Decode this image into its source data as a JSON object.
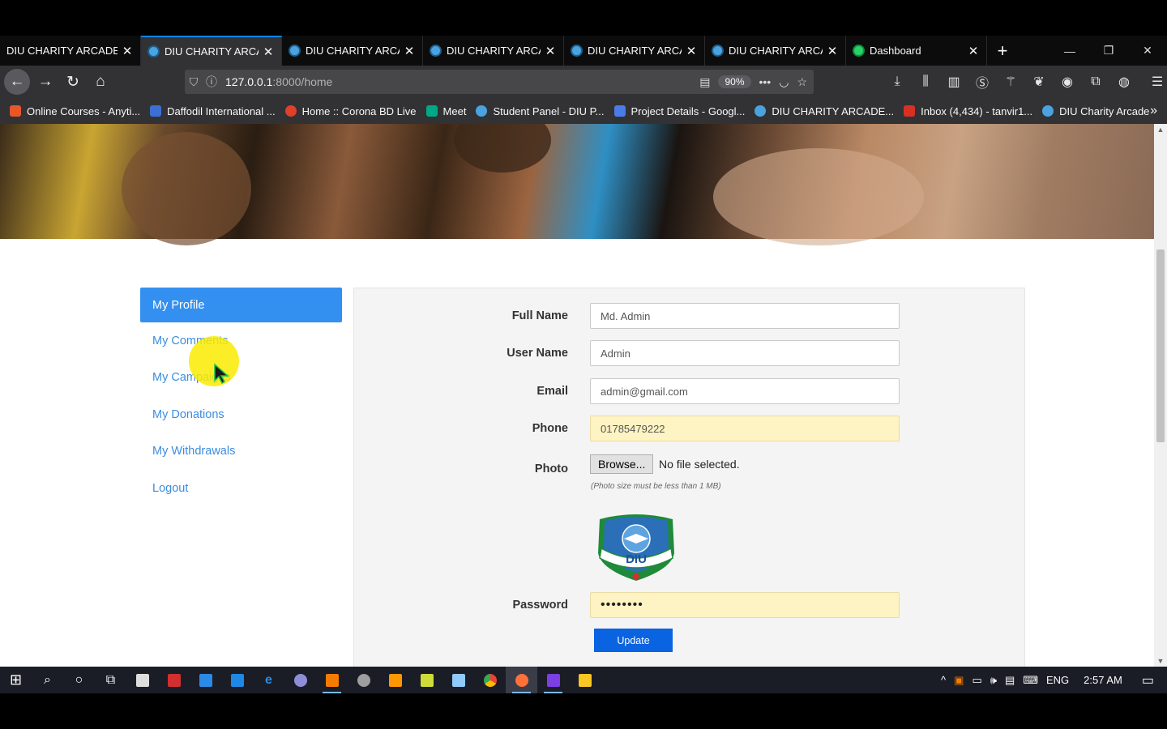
{
  "browser": {
    "tabs": [
      {
        "label": "DIU CHARITY ARCADE|E",
        "active": false,
        "icon": "dev-tab-icon"
      },
      {
        "label": "DIU CHARITY ARCADE",
        "active": true,
        "icon": "diu-favicon"
      },
      {
        "label": "DIU CHARITY ARCADE",
        "active": false,
        "icon": "diu-favicon"
      },
      {
        "label": "DIU CHARITY ARCADE",
        "active": false,
        "icon": "diu-favicon"
      },
      {
        "label": "DIU CHARITY ARCADE",
        "active": false,
        "icon": "diu-favicon"
      },
      {
        "label": "DIU CHARITY ARCADE",
        "active": false,
        "icon": "diu-favicon"
      },
      {
        "label": "Dashboard",
        "active": false,
        "icon": "whatsapp-icon"
      }
    ],
    "url_host": "127.0.0.1",
    "url_path": ":8000/home",
    "zoom": "90%",
    "bookmarks": [
      {
        "label": "Online Courses - Anyti...",
        "color": "#e8562a"
      },
      {
        "label": "Daffodil International ...",
        "color": "#3b6fd6"
      },
      {
        "label": "Home :: Corona BD Live",
        "color": "#e0402a"
      },
      {
        "label": "Meet",
        "color": "#00a884"
      },
      {
        "label": "Student Panel - DIU P...",
        "color": "#4aa3df"
      },
      {
        "label": "Project Details - Googl...",
        "color": "#4a7be8"
      },
      {
        "label": "DIU CHARITY ARCADE...",
        "color": "#4aa3df"
      },
      {
        "label": "Inbox (4,434) - tanvir1...",
        "color": "#d93025"
      },
      {
        "label": "DIU Charity Arcade",
        "color": "#4aa3df"
      }
    ]
  },
  "sidebar": {
    "items": [
      {
        "label": "My Profile",
        "active": true
      },
      {
        "label": "My Comments",
        "active": false
      },
      {
        "label": "My Campaigns",
        "active": false
      },
      {
        "label": "My Donations",
        "active": false
      },
      {
        "label": "My Withdrawals",
        "active": false
      },
      {
        "label": "Logout",
        "active": false
      }
    ]
  },
  "form": {
    "full_name_label": "Full Name",
    "full_name_value": "Md. Admin",
    "user_name_label": "User Name",
    "user_name_value": "Admin",
    "email_label": "Email",
    "email_value": "admin@gmail.com",
    "phone_label": "Phone",
    "phone_value": "01785479222",
    "photo_label": "Photo",
    "browse_label": "Browse...",
    "no_file_text": "No file selected.",
    "photo_hint": "(Photo size must be less than 1 MB)",
    "logo_text": "DIU",
    "password_label": "Password",
    "password_value": "••••••••",
    "update_label": "Update"
  },
  "taskbar": {
    "language": "ENG",
    "time": "2:57 AM"
  },
  "colors": {
    "accent": "#3390f0",
    "link": "#3b8de0",
    "update_button": "#0a63e0",
    "autofill": "#fef3c2"
  }
}
